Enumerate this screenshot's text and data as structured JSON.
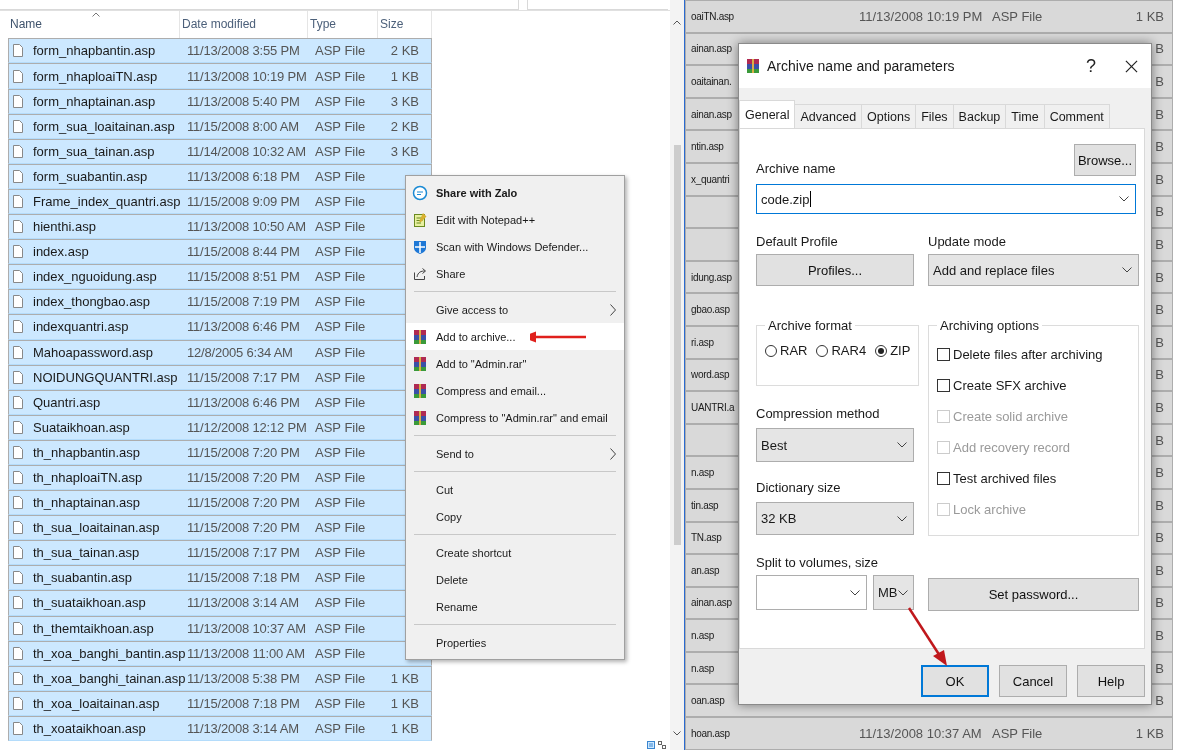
{
  "left_explorer": {
    "columns": [
      {
        "label": "Name",
        "sorted": true
      },
      {
        "label": "Date modified",
        "sorted": false
      },
      {
        "label": "Type",
        "sorted": false
      },
      {
        "label": "Size",
        "sorted": false
      }
    ],
    "rows": [
      {
        "name": "form_nhapbantin.asp",
        "date": "11/13/2008 3:55 PM",
        "type": "ASP File",
        "size": "2 KB",
        "selected": true
      },
      {
        "name": "form_nhaploaiTN.asp",
        "date": "11/13/2008 10:19 PM",
        "type": "ASP File",
        "size": "1 KB",
        "selected": true
      },
      {
        "name": "form_nhaptainan.asp",
        "date": "11/13/2008 5:40 PM",
        "type": "ASP File",
        "size": "3 KB",
        "selected": true
      },
      {
        "name": "form_sua_loaitainan.asp",
        "date": "11/15/2008 8:00 AM",
        "type": "ASP File",
        "size": "2 KB",
        "selected": true
      },
      {
        "name": "form_sua_tainan.asp",
        "date": "11/14/2008 10:32 AM",
        "type": "ASP File",
        "size": "3 KB",
        "selected": true
      },
      {
        "name": "form_suabantin.asp",
        "date": "11/13/2008 6:18 PM",
        "type": "ASP File",
        "selected": true
      },
      {
        "name": "Frame_index_quantri.asp",
        "date": "11/15/2008 9:09 PM",
        "type": "ASP File",
        "selected": true
      },
      {
        "name": "hienthi.asp",
        "date": "11/13/2008 10:50 AM",
        "type": "ASP File",
        "selected": true
      },
      {
        "name": "index.asp",
        "date": "11/15/2008 8:44 PM",
        "type": "ASP File",
        "selected": true
      },
      {
        "name": "index_nguoidung.asp",
        "date": "11/15/2008 8:51 PM",
        "type": "ASP File",
        "selected": true
      },
      {
        "name": "index_thongbao.asp",
        "date": "11/15/2008 7:19 PM",
        "type": "ASP File",
        "selected": true
      },
      {
        "name": "indexquantri.asp",
        "date": "11/13/2008 6:46 PM",
        "type": "ASP File",
        "selected": true
      },
      {
        "name": "Mahoapassword.asp",
        "date": "12/8/2005 6:34 AM",
        "type": "ASP File",
        "selected": true
      },
      {
        "name": "NOIDUNGQUANTRI.asp",
        "date": "11/15/2008 7:17 PM",
        "type": "ASP File",
        "selected": true
      },
      {
        "name": "Quantri.asp",
        "date": "11/13/2008 6:46 PM",
        "type": "ASP File",
        "selected": true
      },
      {
        "name": "Suataikhoan.asp",
        "date": "11/12/2008 12:12 PM",
        "type": "ASP File",
        "selected": true
      },
      {
        "name": "th_nhapbantin.asp",
        "date": "11/15/2008 7:20 PM",
        "type": "ASP File",
        "selected": true
      },
      {
        "name": "th_nhaploaiTN.asp",
        "date": "11/15/2008 7:20 PM",
        "type": "ASP File",
        "selected": true
      },
      {
        "name": "th_nhaptainan.asp",
        "date": "11/15/2008 7:20 PM",
        "type": "ASP File",
        "selected": true
      },
      {
        "name": "th_sua_loaitainan.asp",
        "date": "11/15/2008 7:20 PM",
        "type": "ASP File",
        "selected": true
      },
      {
        "name": "th_sua_tainan.asp",
        "date": "11/15/2008 7:17 PM",
        "type": "ASP File",
        "selected": true
      },
      {
        "name": "th_suabantin.asp",
        "date": "11/15/2008 7:18 PM",
        "type": "ASP File",
        "selected": true
      },
      {
        "name": "th_suataikhoan.asp",
        "date": "11/13/2008 3:14 AM",
        "type": "ASP File",
        "selected": true
      },
      {
        "name": "th_themtaikhoan.asp",
        "date": "11/13/2008 10:37 AM",
        "type": "ASP File",
        "selected": true
      },
      {
        "name": "th_xoa_banghi_bantin.asp",
        "date": "11/13/2008 11:00 AM",
        "type": "ASP File",
        "selected": true
      },
      {
        "name": "th_xoa_banghi_tainan.asp",
        "date": "11/13/2008 5:38 PM",
        "type": "ASP File",
        "size": "1 KB",
        "selected": true
      },
      {
        "name": "th_xoa_loaitainan.asp",
        "date": "11/15/2008 7:18 PM",
        "type": "ASP File",
        "size": "1 KB",
        "selected": true
      },
      {
        "name": "th_xoataikhoan.asp",
        "date": "11/13/2008 3:14 AM",
        "type": "ASP File",
        "size": "1 KB",
        "selected": true
      }
    ]
  },
  "context_menu": {
    "sections": [
      [
        {
          "label": "Share with Zalo",
          "default": true,
          "submenu": false,
          "selected": false
        },
        {
          "label": "Edit with Notepad++",
          "default": false,
          "submenu": false,
          "selected": false
        },
        {
          "label": "Scan with Windows Defender...",
          "default": false,
          "submenu": false,
          "selected": false
        },
        {
          "label": "Share",
          "default": false,
          "submenu": false,
          "selected": false
        }
      ],
      [
        {
          "label": "Give access to",
          "default": false,
          "submenu": true,
          "selected": false
        },
        {
          "label": "Add to archive...",
          "default": false,
          "submenu": false,
          "selected": true
        },
        {
          "label": "Add to \"Admin.rar\"",
          "default": false,
          "submenu": false,
          "selected": false
        },
        {
          "label": "Compress and email...",
          "default": false,
          "submenu": false,
          "selected": false
        },
        {
          "label": "Compress to \"Admin.rar\" and email",
          "default": false,
          "submenu": false,
          "selected": false
        }
      ],
      [
        {
          "label": "Send to",
          "default": false,
          "submenu": true,
          "selected": false
        }
      ],
      [
        {
          "label": "Cut",
          "default": false,
          "submenu": false,
          "selected": false
        },
        {
          "label": "Copy",
          "default": false,
          "submenu": false,
          "selected": false
        }
      ],
      [
        {
          "label": "Create shortcut",
          "default": false,
          "submenu": false,
          "selected": false
        },
        {
          "label": "Delete",
          "default": false,
          "submenu": false,
          "selected": false
        },
        {
          "label": "Rename",
          "default": false,
          "submenu": false,
          "selected": false
        }
      ],
      [
        {
          "label": "Properties",
          "default": false,
          "submenu": false,
          "selected": false
        }
      ]
    ]
  },
  "right_explorer": {
    "rows": [
      {
        "name": "oaiTN.asp",
        "date": "11/13/2008 10:19 PM",
        "type": "ASP File",
        "size": "1 KB",
        "selected": true
      },
      {
        "name": "ainan.asp",
        "size": "B",
        "selected": true
      },
      {
        "name": "oaitainan.",
        "size": "B",
        "selected": true
      },
      {
        "name": "ainan.asp",
        "size": "B",
        "selected": true
      },
      {
        "name": "ntin.asp",
        "size": "B",
        "selected": true
      },
      {
        "name": "x_quantri",
        "size": "B",
        "selected": true
      },
      {
        "size": "B",
        "selected": true
      },
      {
        "size": "B",
        "selected": true
      },
      {
        "name": "idung.asp",
        "size": "B",
        "selected": true
      },
      {
        "name": "gbao.asp",
        "size": "B",
        "selected": true
      },
      {
        "name": "ri.asp",
        "size": "B",
        "selected": true
      },
      {
        "name": "word.asp",
        "size": "B",
        "selected": true
      },
      {
        "name": "UANTRI.a",
        "size": "B",
        "selected": true
      },
      {
        "size": "B",
        "selected": true
      },
      {
        "name": "n.asp",
        "size": "B",
        "selected": true
      },
      {
        "name": "tin.asp",
        "size": "B",
        "selected": true
      },
      {
        "name": "TN.asp",
        "size": "B",
        "selected": true
      },
      {
        "name": "an.asp",
        "size": "B",
        "selected": true
      },
      {
        "name": "ainan.asp",
        "size": "B",
        "selected": true
      },
      {
        "name": "n.asp",
        "size": "B",
        "selected": true
      },
      {
        "name": "n.asp",
        "size": "B",
        "selected": true
      },
      {
        "name": "oan.asp",
        "size": "B",
        "selected": true
      },
      {
        "name": "hoan.asp",
        "date": "11/13/2008 10:37 AM",
        "type": "ASP File",
        "size": "1 KB",
        "selected": true
      }
    ]
  },
  "dialog": {
    "title": "Archive name and parameters",
    "help": "?",
    "tabs": [
      {
        "label": "General",
        "selected": true
      },
      {
        "label": "Advanced",
        "selected": false
      },
      {
        "label": "Options",
        "selected": false
      },
      {
        "label": "Files",
        "selected": false
      },
      {
        "label": "Backup",
        "selected": false
      },
      {
        "label": "Time",
        "selected": false
      },
      {
        "label": "Comment",
        "selected": false
      }
    ],
    "archive_name": {
      "label": "Archive name",
      "value": "code.zip"
    },
    "browse_button": "Browse...",
    "default_profile": {
      "label": "Default Profile",
      "button": "Profiles..."
    },
    "update_mode": {
      "label": "Update mode",
      "value": "Add and replace files"
    },
    "archive_format": {
      "label": "Archive format",
      "options": [
        {
          "label": "RAR",
          "selected": false
        },
        {
          "label": "RAR4",
          "selected": false
        },
        {
          "label": "ZIP",
          "selected": true
        }
      ]
    },
    "archiving_options": {
      "label": "Archiving options",
      "options": [
        {
          "label": "Delete files after archiving",
          "checked": false,
          "disabled": false
        },
        {
          "label": "Create SFX archive",
          "checked": false,
          "disabled": false
        },
        {
          "label": "Create solid archive",
          "checked": false,
          "disabled": true
        },
        {
          "label": "Add recovery record",
          "checked": false,
          "disabled": true
        },
        {
          "label": "Test archived files",
          "checked": false,
          "disabled": false
        },
        {
          "label": "Lock archive",
          "checked": false,
          "disabled": true
        }
      ]
    },
    "compression_method": {
      "label": "Compression method",
      "value": "Best"
    },
    "dictionary_size": {
      "label": "Dictionary size",
      "value": "32 KB"
    },
    "split_volumes": {
      "label": "Split to volumes, size",
      "unit": "MB"
    },
    "password_button": "Set password...",
    "buttons": [
      {
        "label": "OK",
        "default": true
      },
      {
        "label": "Cancel",
        "default": false
      },
      {
        "label": "Help",
        "default": false
      }
    ]
  }
}
